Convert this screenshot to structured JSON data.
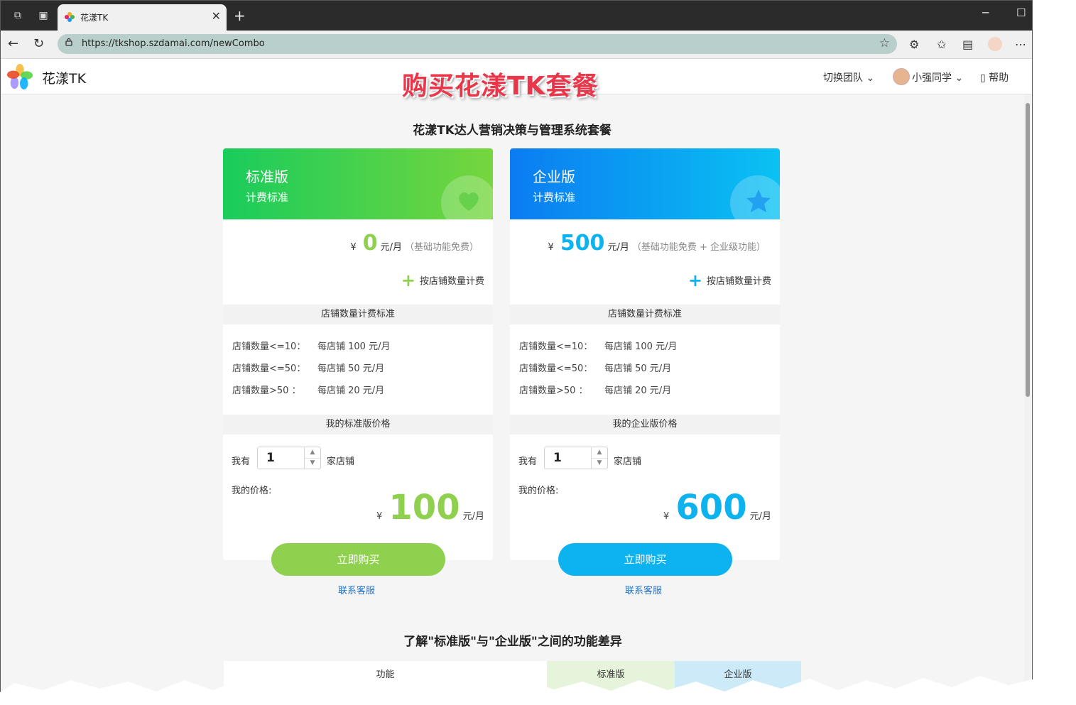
{
  "browser": {
    "tab_title": "花漾TK",
    "url": "https://tkshop.szdamai.com/newCombo"
  },
  "header": {
    "brand": "花漾TK",
    "banner": "购买花漾TK套餐",
    "switch_team": "切换团队",
    "user": "小强同学",
    "help": "帮助"
  },
  "page": {
    "title": "花漾TK达人营销决策与管理系统套餐",
    "compare_title": "了解\"标准版\"与\"企业版\"之间的功能差异",
    "compare_headers": [
      "功能",
      "标准版",
      "企业版"
    ]
  },
  "plans": {
    "standard": {
      "name": "标准版",
      "subtitle": "计费标准",
      "currency": "¥",
      "base_price": "0",
      "unit": "元/月",
      "note": "（基础功能免费）",
      "addon": "按店铺数量计费",
      "tier_header": "店铺数量计费标准",
      "tiers": [
        {
          "label": "店铺数量<=10：",
          "price": "每店铺 100 元/月"
        },
        {
          "label": "店铺数量<=50：",
          "price": "每店铺 50 元/月"
        },
        {
          "label": "店铺数量>50 ：",
          "price": "每店铺 20 元/月"
        }
      ],
      "my_header": "我的标准版价格",
      "i_have": "我有",
      "shop_count": "1",
      "shops_suffix": "家店铺",
      "my_price_label": "我的价格:",
      "total": "100",
      "buy": "立即购买",
      "service": "联系客服",
      "color": "#8fd14f"
    },
    "enterprise": {
      "name": "企业版",
      "subtitle": "计费标准",
      "currency": "¥",
      "base_price": "500",
      "unit": "元/月",
      "note": "（基础功能免费 + 企业级功能）",
      "addon": "按店铺数量计费",
      "tier_header": "店铺数量计费标准",
      "tiers": [
        {
          "label": "店铺数量<=10：",
          "price": "每店铺 100 元/月"
        },
        {
          "label": "店铺数量<=50：",
          "price": "每店铺 50 元/月"
        },
        {
          "label": "店铺数量>50 ：",
          "price": "每店铺 20 元/月"
        }
      ],
      "my_header": "我的企业版价格",
      "i_have": "我有",
      "shop_count": "1",
      "shops_suffix": "家店铺",
      "my_price_label": "我的价格:",
      "total": "600",
      "buy": "立即购买",
      "service": "联系客服",
      "color": "#0cb3ef"
    }
  }
}
